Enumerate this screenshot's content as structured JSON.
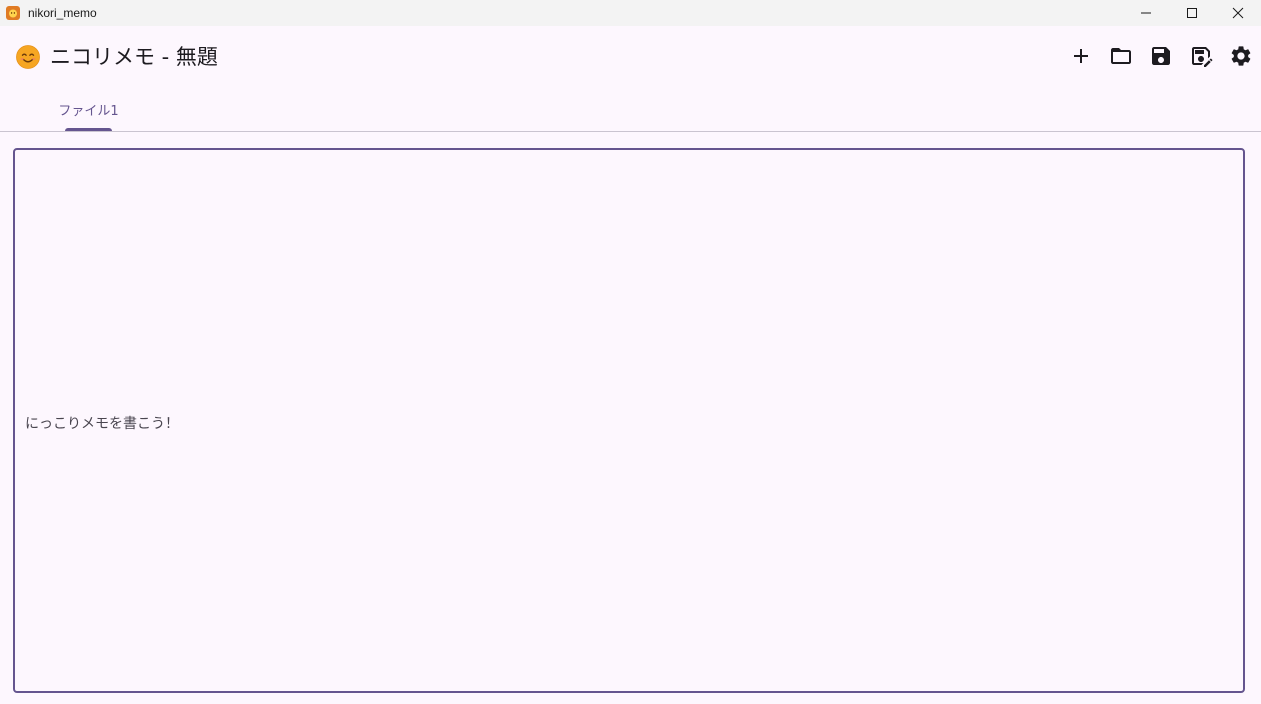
{
  "window": {
    "title": "nikori_memo",
    "controls": [
      "minimize-icon",
      "maximize-icon",
      "close-icon"
    ]
  },
  "appbar": {
    "icon": "smiling-face-emoji",
    "title": "ニコリメモ - 無題",
    "actions": [
      {
        "name": "new-file-button",
        "icon": "plus-icon"
      },
      {
        "name": "open-folder-button",
        "icon": "folder-icon"
      },
      {
        "name": "save-button",
        "icon": "save-icon"
      },
      {
        "name": "save-as-button",
        "icon": "save-edit-icon"
      },
      {
        "name": "settings-button",
        "icon": "gear-icon"
      }
    ]
  },
  "tabs": [
    {
      "label": "ファイル1",
      "active": true
    }
  ],
  "editor": {
    "placeholder": "にっこりメモを書こう！",
    "value": ""
  },
  "colors": {
    "background": "#fdf7fe",
    "accent": "#65558f",
    "divider": "#cac4d0",
    "emoji": "#f6a623"
  }
}
